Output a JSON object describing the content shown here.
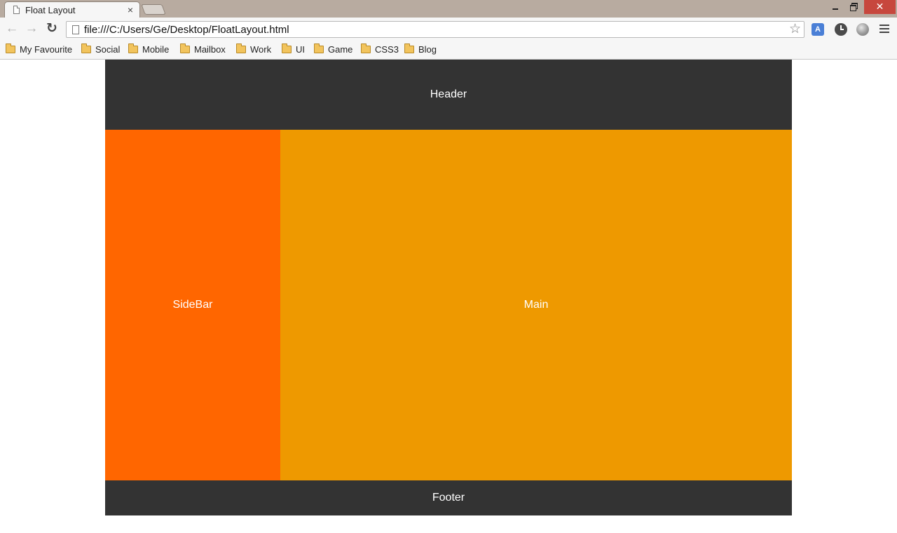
{
  "browser": {
    "tab_title": "Float Layout",
    "tab_close": "×",
    "window_close": "✕",
    "url": "file:///C:/Users/Ge/Desktop/FloatLayout.html",
    "bookmarks": [
      "My Favourite",
      "Social",
      "Mobile",
      "Mailbox",
      "Work",
      "UI",
      "Game",
      "CSS3",
      "Blog"
    ],
    "icons": [
      "back-arrow-icon",
      "forward-arrow-icon",
      "reload-icon",
      "page-icon",
      "star-icon",
      "translate-icon",
      "clock-icon",
      "globe-icon",
      "menu-icon",
      "folder-icon"
    ]
  },
  "page": {
    "header": "Header",
    "sidebar": "SideBar",
    "main": "Main",
    "footer": "Footer"
  },
  "colors": {
    "header_bg": "#333333",
    "sidebar_bg": "#ff6600",
    "main_bg": "#ee9900",
    "footer_bg": "#333333",
    "text": "#ffffff"
  }
}
